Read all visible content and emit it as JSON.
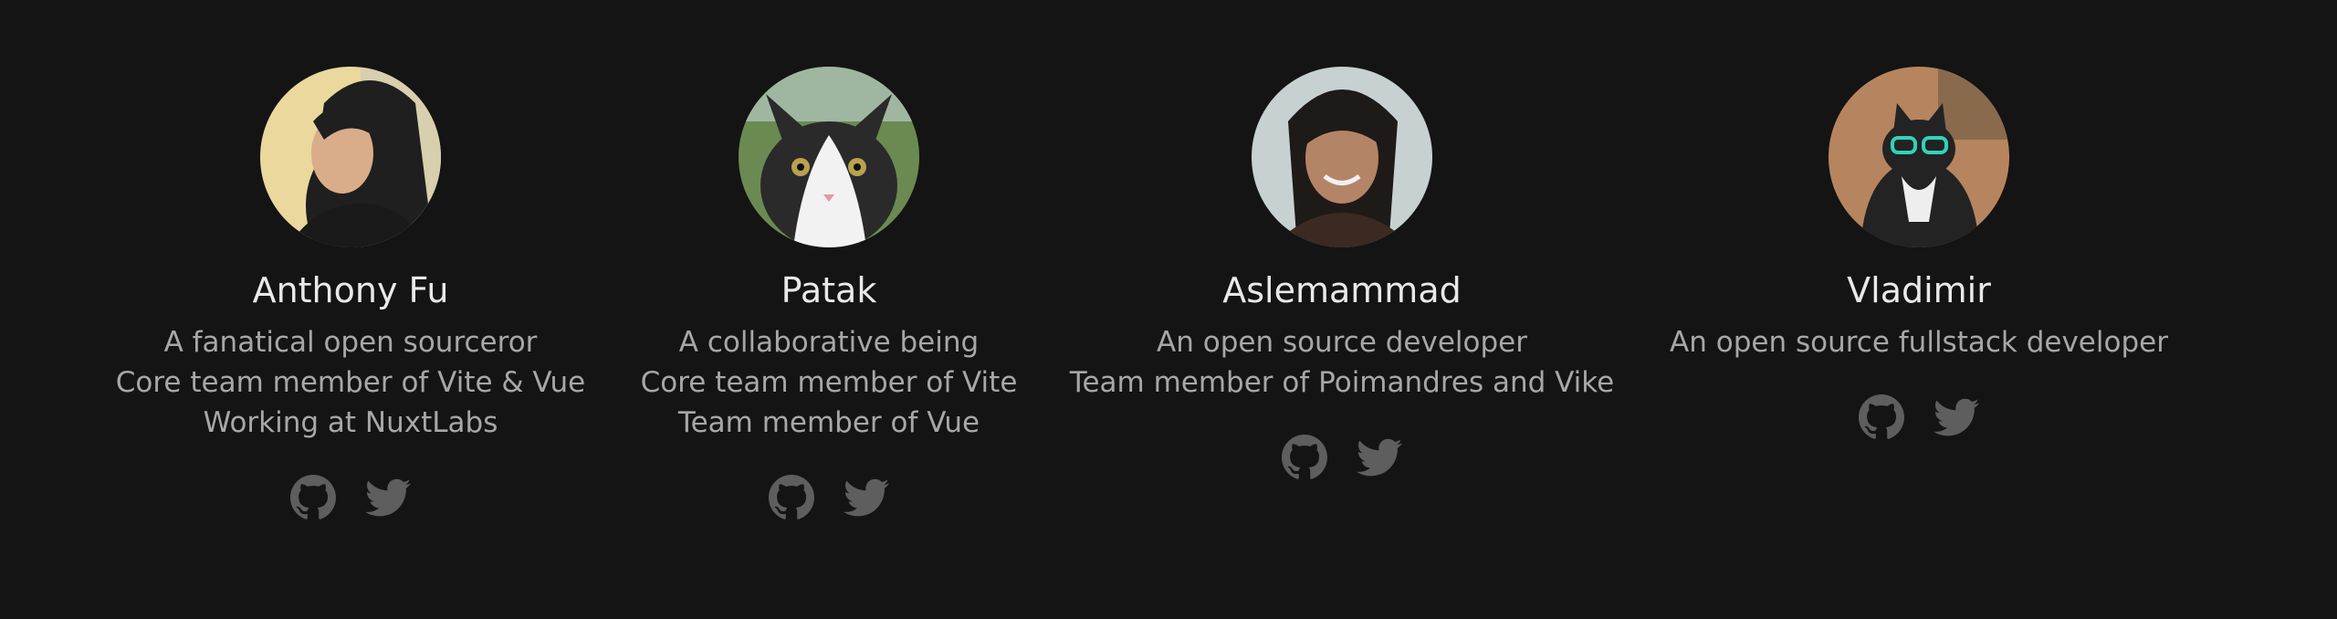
{
  "members": [
    {
      "name": "Anthony Fu",
      "lines": [
        "A fanatical open sourceror",
        "Core team member of Vite & Vue",
        "Working at NuxtLabs"
      ],
      "avatar_colors": [
        "#e9d9a0",
        "#1d1d1d",
        "#d8ad8b"
      ],
      "links": [
        "github-icon",
        "twitter-icon"
      ]
    },
    {
      "name": "Patak",
      "lines": [
        "A collaborative being",
        "Core team member of Vite",
        "Team member of Vue"
      ],
      "avatar_colors": [
        "#6d8a55",
        "#f2f2f2",
        "#2a2a2a"
      ],
      "links": [
        "github-icon",
        "twitter-icon"
      ]
    },
    {
      "name": "Aslemammad",
      "lines": [
        "An open source developer",
        "Team member of Poimandres and Vike"
      ],
      "avatar_colors": [
        "#c9d3d3",
        "#3b2a22",
        "#b68468"
      ],
      "links": [
        "github-icon",
        "twitter-icon"
      ]
    },
    {
      "name": "Vladimir",
      "lines": [
        "An open source fullstack developer"
      ],
      "avatar_colors": [
        "#b88561",
        "#232323",
        "#2fd4b9"
      ],
      "links": [
        "github-icon",
        "twitter-icon"
      ]
    }
  ]
}
